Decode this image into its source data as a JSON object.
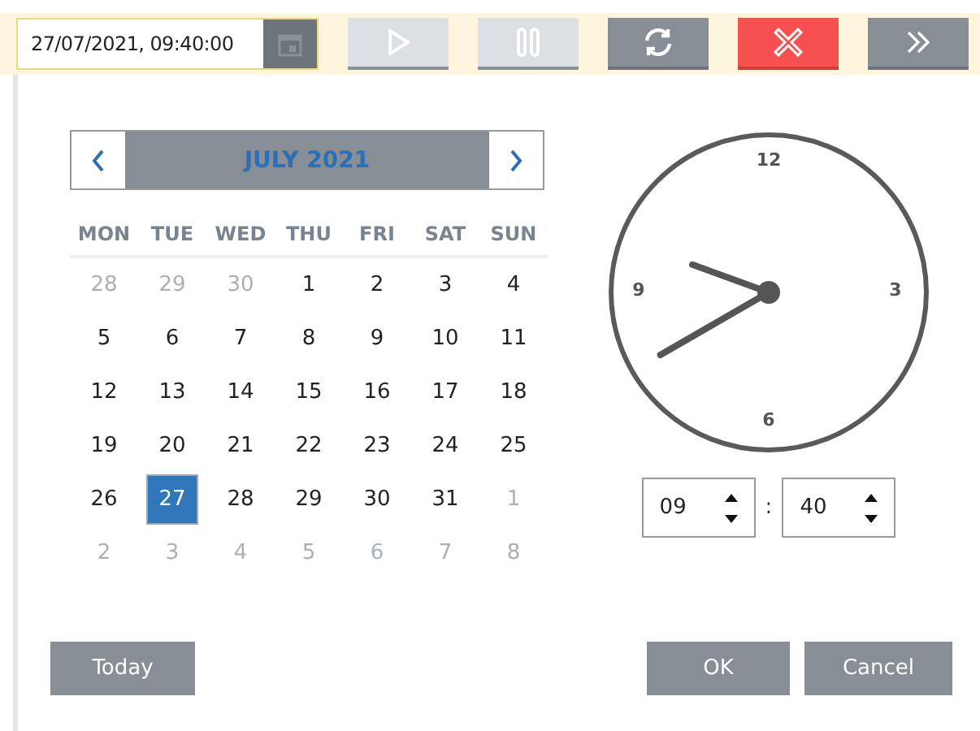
{
  "toolbar": {
    "datetime": "27/07/2021, 09:40:00",
    "buttons": [
      {
        "kind": "play",
        "disabled": true
      },
      {
        "kind": "pause",
        "disabled": true
      },
      {
        "kind": "refresh",
        "disabled": false
      },
      {
        "kind": "stop",
        "disabled": false
      },
      {
        "kind": "forward",
        "disabled": false
      }
    ]
  },
  "calendar": {
    "month": "JULY 2021",
    "weekdays": [
      "MON",
      "TUE",
      "WED",
      "THU",
      "FRI",
      "SAT",
      "SUN"
    ],
    "weeks": [
      [
        {
          "day": "28",
          "other": true,
          "selected": false
        },
        {
          "day": "29",
          "other": true,
          "selected": false
        },
        {
          "day": "30",
          "other": true,
          "selected": false
        },
        {
          "day": "1",
          "other": false,
          "selected": false
        },
        {
          "day": "2",
          "other": false,
          "selected": false
        },
        {
          "day": "3",
          "other": false,
          "selected": false
        },
        {
          "day": "4",
          "other": false,
          "selected": false
        }
      ],
      [
        {
          "day": "5",
          "other": false,
          "selected": false
        },
        {
          "day": "6",
          "other": false,
          "selected": false
        },
        {
          "day": "7",
          "other": false,
          "selected": false
        },
        {
          "day": "8",
          "other": false,
          "selected": false
        },
        {
          "day": "9",
          "other": false,
          "selected": false
        },
        {
          "day": "10",
          "other": false,
          "selected": false
        },
        {
          "day": "11",
          "other": false,
          "selected": false
        }
      ],
      [
        {
          "day": "12",
          "other": false,
          "selected": false
        },
        {
          "day": "13",
          "other": false,
          "selected": false
        },
        {
          "day": "14",
          "other": false,
          "selected": false
        },
        {
          "day": "15",
          "other": false,
          "selected": false
        },
        {
          "day": "16",
          "other": false,
          "selected": false
        },
        {
          "day": "17",
          "other": false,
          "selected": false
        },
        {
          "day": "18",
          "other": false,
          "selected": false
        }
      ],
      [
        {
          "day": "19",
          "other": false,
          "selected": false
        },
        {
          "day": "20",
          "other": false,
          "selected": false
        },
        {
          "day": "21",
          "other": false,
          "selected": false
        },
        {
          "day": "22",
          "other": false,
          "selected": false
        },
        {
          "day": "23",
          "other": false,
          "selected": false
        },
        {
          "day": "24",
          "other": false,
          "selected": false
        },
        {
          "day": "25",
          "other": false,
          "selected": false
        }
      ],
      [
        {
          "day": "26",
          "other": false,
          "selected": false
        },
        {
          "day": "27",
          "other": false,
          "selected": true
        },
        {
          "day": "28",
          "other": false,
          "selected": false
        },
        {
          "day": "29",
          "other": false,
          "selected": false
        },
        {
          "day": "30",
          "other": false,
          "selected": false
        },
        {
          "day": "31",
          "other": false,
          "selected": false
        },
        {
          "day": "1",
          "other": true,
          "selected": false
        }
      ],
      [
        {
          "day": "2",
          "other": true,
          "selected": false
        },
        {
          "day": "3",
          "other": true,
          "selected": false
        },
        {
          "day": "4",
          "other": true,
          "selected": false
        },
        {
          "day": "5",
          "other": true,
          "selected": false
        },
        {
          "day": "6",
          "other": true,
          "selected": false
        },
        {
          "day": "7",
          "other": true,
          "selected": false
        },
        {
          "day": "8",
          "other": true,
          "selected": false
        }
      ]
    ]
  },
  "clock": {
    "numerals": [
      "12",
      "3",
      "6",
      "9"
    ],
    "hour": "09",
    "separator": ":",
    "minute": "40"
  },
  "buttons": {
    "today": "Today",
    "ok": "OK",
    "cancel": "Cancel"
  }
}
